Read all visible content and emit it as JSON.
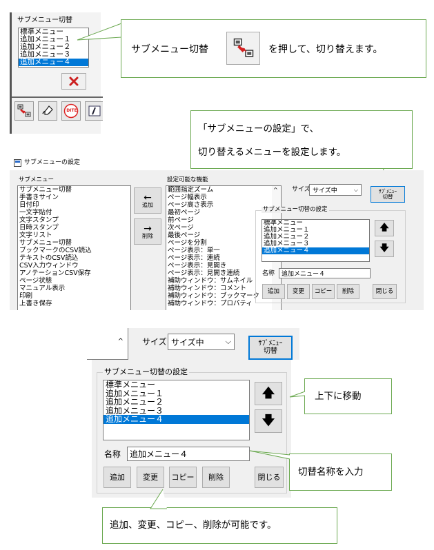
{
  "panel1": {
    "group_label": "サブメニュー切替",
    "items": [
      "標準メニュー",
      "追加メニュー１",
      "追加メニュー２",
      "追加メニュー３",
      "追加メニュー４"
    ],
    "selected_index": 4,
    "toolbar_icon_labels": {
      "dite": "DITE"
    }
  },
  "callout_switch": {
    "before": "サブメニュー切替",
    "after": "を押して、切り替えます。"
  },
  "callout_settings": {
    "line1": "「サブメニューの設定」で、",
    "line2": "切り替えるメニューを設定します。"
  },
  "dialog": {
    "title": "サブメニューの設定",
    "submenu_label": "サブメニュー",
    "submenu_items": [
      "サブメニュー切替",
      "手書きサイン",
      "日付印",
      "一文字貼付",
      "文字スタンプ",
      "日時スタンプ",
      "文字リスト",
      "サブメニュー切替",
      "ブックマークのCSV読込",
      "テキストのCSV読込",
      "CSV入力ウィンドウ",
      "アノテーションCSV保存",
      "ページ状態",
      "マニュアル表示",
      "印刷",
      "上書き保存"
    ],
    "add_label": "追加",
    "delete_label": "削除",
    "available_label": "設定可能な機能",
    "available_items": [
      "範囲指定ズーム",
      "ページ幅表示",
      "ページ高さ表示",
      "最初ページ",
      "前ページ",
      "次ページ",
      "最後ページ",
      "ページを分割",
      "ページ表示：単一",
      "ページ表示：連続",
      "ページ表示：見開き",
      "ページ表示：見開き連続",
      "補助ウィンドウ：サムネイル",
      "補助ウィンドウ：コメント",
      "補助ウィンドウ：ブックマーク",
      "補助ウィンドウ：プロパティ"
    ],
    "size_label": "サイズ",
    "size_value": "サイズ中",
    "submenu_switch_btn": {
      "line1": "ｻﾌﾞﾒﾆｭｰ",
      "line2": "切替"
    },
    "group_label": "サブメニュー切替の設定",
    "switch_items": [
      "標準メニュー",
      "追加メニュー１",
      "追加メニュー２",
      "追加メニュー３",
      "追加メニュー４"
    ],
    "selected_index": 4,
    "name_label": "名称",
    "name_value": "追加メニュー４",
    "btn_add": "追加",
    "btn_change": "変更",
    "btn_copy": "コピー",
    "btn_delete": "削除",
    "btn_close": "閉じる"
  },
  "zoom": {
    "size_label": "サイズ",
    "size_value": "サイズ中",
    "submenu_switch_btn": {
      "line1": "ｻﾌﾞﾒﾆｭｰ",
      "line2": "切替"
    },
    "group_label": "サブメニュー切替の設定",
    "items": [
      "標準メニュー",
      "追加メニュー１",
      "追加メニュー２",
      "追加メニュー３",
      "追加メニュー４"
    ],
    "selected_index": 4,
    "name_label": "名称",
    "name_value": "追加メニュー４",
    "btn_add": "追加",
    "btn_change": "変更",
    "btn_copy": "コピー",
    "btn_delete": "削除",
    "btn_close": "閉じる"
  },
  "callout_move": "上下に移動",
  "callout_name": "切替名称を入力",
  "callout_buttons": "追加、変更、コピー、削除が可能です。",
  "colors": {
    "accent": "#0078d7",
    "callout_border": "#6aa84f",
    "delete_x": "#cc1f1f"
  }
}
